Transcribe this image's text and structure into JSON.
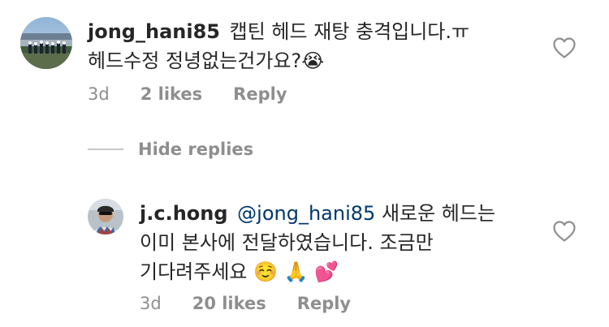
{
  "comments": [
    {
      "username": "jong_hani85",
      "text": "캡틴 헤드 재탕 충격입니다.ㅠ 헤드수정 정녕없는건가요?😭",
      "time": "3d",
      "likes": "2 likes",
      "reply": "Reply"
    }
  ],
  "hide_replies_label": "Hide replies",
  "replies": [
    {
      "username": "j.c.hong",
      "mention": "@jong_hani85",
      "text": " 새로운 헤드는 이미 본사에 전달하였습니다. 조금만 기다려주세요 ☺️ 🙏 💕",
      "time": "3d",
      "likes": "20 likes",
      "reply": "Reply"
    }
  ],
  "icons": {
    "like": "heart-outline-icon"
  },
  "colors": {
    "text": "#262626",
    "secondary": "#8e8e8e",
    "mention": "#00376b",
    "divider": "#c7c7c7"
  }
}
